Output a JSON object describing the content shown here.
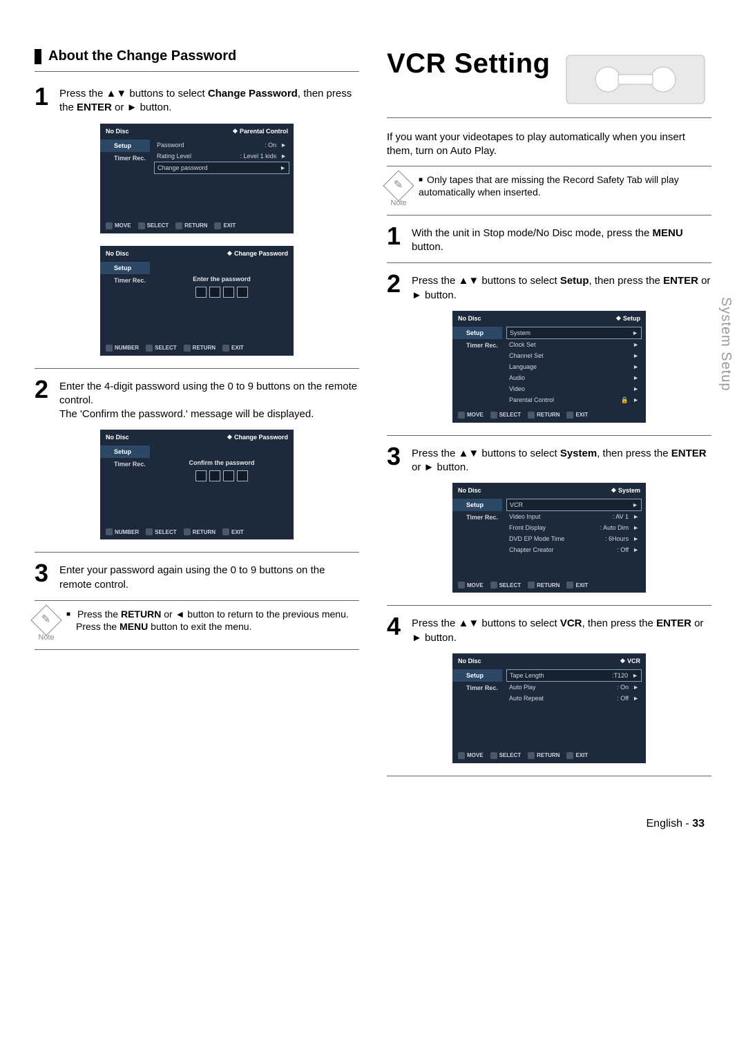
{
  "left": {
    "heading": "About the Change Password",
    "step1": {
      "text_a": "Press the ",
      "arrows": "▲▼",
      "text_b": " buttons to select ",
      "bold1": "Change Password",
      "text_c": ", then press the ",
      "bold2": "ENTER",
      "text_d": " or ",
      "play": "►",
      "text_e": " button."
    },
    "osd1": {
      "nodisc": "No Disc",
      "crumb": "Parental Control",
      "side": [
        "Setup",
        "Timer Rec."
      ],
      "rows": [
        {
          "label": "Password",
          "value": ": On",
          "arrow": "►",
          "sel": false
        },
        {
          "label": "Rating Level",
          "value": ": Level 1 kids",
          "arrow": "►",
          "sel": false
        },
        {
          "label": "Change password",
          "value": "",
          "arrow": "►",
          "sel": true
        }
      ],
      "hints": [
        "MOVE",
        "SELECT",
        "RETURN",
        "EXIT"
      ]
    },
    "osd2": {
      "nodisc": "No Disc",
      "crumb": "Change Password",
      "side": [
        "Setup",
        "Timer Rec."
      ],
      "msg": "Enter the password",
      "hints": [
        "NUMBER",
        "SELECT",
        "RETURN",
        "EXIT"
      ]
    },
    "step2": {
      "line1": "Enter the 4-digit password using the 0 to 9 buttons on the remote control.",
      "line2": "The 'Confirm the password.' message will be displayed."
    },
    "osd3": {
      "nodisc": "No Disc",
      "crumb": "Change Password",
      "side": [
        "Setup",
        "Timer Rec."
      ],
      "msg": "Confirm the password",
      "hints": [
        "NUMBER",
        "SELECT",
        "RETURN",
        "EXIT"
      ]
    },
    "step3": "Enter your password again using the 0 to 9 buttons on the remote control.",
    "note": {
      "label": "Note",
      "line1a": "Press the ",
      "bold1": "RETURN",
      "line1b": " or ",
      "left": "◄",
      "line1c": " button to return to the previous menu.",
      "line2a": "Press the ",
      "bold2": "MENU",
      "line2b": " button to exit the menu."
    }
  },
  "right": {
    "title": "VCR Setting",
    "intro": "If you want your videotapes to play automatically when you insert them, turn on Auto Play.",
    "note": {
      "label": "Note",
      "text": "Only tapes that are missing the Record Safety Tab will play automatically when inserted."
    },
    "step1": {
      "a": "With the unit in Stop mode/No Disc mode, press the ",
      "bold": "MENU",
      "b": " button."
    },
    "step2": {
      "a": "Press the ",
      "arrows": "▲▼",
      "b": " buttons to select ",
      "bold1": "Setup",
      "c": ", then press the ",
      "bold2": "ENTER",
      "d": " or ",
      "play": "►",
      "e": " button."
    },
    "osd_setup": {
      "nodisc": "No Disc",
      "crumb": "Setup",
      "side": [
        "Setup",
        "Timer Rec."
      ],
      "rows": [
        {
          "label": "System",
          "value": "",
          "arrow": "►",
          "sel": true
        },
        {
          "label": "Clock Set",
          "value": "",
          "arrow": "►",
          "sel": false
        },
        {
          "label": "Channel Set",
          "value": "",
          "arrow": "►",
          "sel": false
        },
        {
          "label": "Language",
          "value": "",
          "arrow": "►",
          "sel": false
        },
        {
          "label": "Audio",
          "value": "",
          "arrow": "►",
          "sel": false
        },
        {
          "label": "Video",
          "value": "",
          "arrow": "►",
          "sel": false
        },
        {
          "label": "Parental Control",
          "value": "",
          "arrow": "►",
          "sel": false,
          "lock": true
        }
      ],
      "hints": [
        "MOVE",
        "SELECT",
        "RETURN",
        "EXIT"
      ]
    },
    "step3": {
      "a": "Press the ",
      "arrows": "▲▼",
      "b": " buttons to select ",
      "bold1": "System",
      "c": ", then press the ",
      "bold2": "ENTER",
      "d": " or ",
      "play": "►",
      "e": " button."
    },
    "osd_system": {
      "nodisc": "No Disc",
      "crumb": "System",
      "side": [
        "Setup",
        "Timer Rec."
      ],
      "rows": [
        {
          "label": "VCR",
          "value": "",
          "arrow": "►",
          "sel": true
        },
        {
          "label": "Video Input",
          "value": ": AV 1",
          "arrow": "►",
          "sel": false
        },
        {
          "label": "Front Display",
          "value": ": Auto Dim",
          "arrow": "►",
          "sel": false
        },
        {
          "label": "DVD EP Mode Time",
          "value": ": 6Hours",
          "arrow": "►",
          "sel": false
        },
        {
          "label": "Chapter Creator",
          "value": ": Off",
          "arrow": "►",
          "sel": false
        }
      ],
      "hints": [
        "MOVE",
        "SELECT",
        "RETURN",
        "EXIT"
      ]
    },
    "step4": {
      "a": "Press the ",
      "arrows": "▲▼",
      "b": " buttons to select ",
      "bold1": "VCR",
      "c": ", then press the ",
      "bold2": "ENTER",
      "d": " or ",
      "play": "►",
      "e": " button."
    },
    "osd_vcr": {
      "nodisc": "No Disc",
      "crumb": "VCR",
      "side": [
        "Setup",
        "Timer Rec."
      ],
      "rows": [
        {
          "label": "Tape Length",
          "value": ":T120",
          "arrow": "►",
          "sel": true
        },
        {
          "label": "Auto Play",
          "value": ": On",
          "arrow": "►",
          "sel": false
        },
        {
          "label": "Auto Repeat",
          "value": ": Off",
          "arrow": "►",
          "sel": false
        }
      ],
      "hints": [
        "MOVE",
        "SELECT",
        "RETURN",
        "EXIT"
      ]
    }
  },
  "side_tab": "System Setup",
  "footer": {
    "lang": "English",
    "sep": " - ",
    "page": "33"
  }
}
